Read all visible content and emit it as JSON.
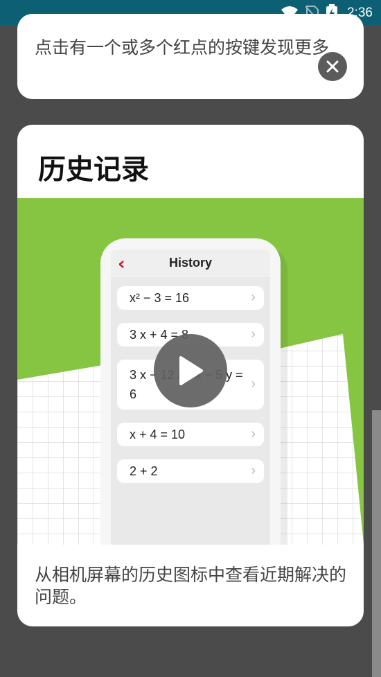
{
  "status": {
    "time": "2:36"
  },
  "top_card": {
    "text": "点击有一个或多个红点的按键发现更多"
  },
  "history_card": {
    "title": "历史记录",
    "description": "从相机屏幕的历史图标中查看近期解决的问题。",
    "phone": {
      "header_title": "History",
      "rows": [
        "x² − 3 = 16",
        "3 x + 4 = 8",
        "3 x − 12 / 4 x − 5 y = 6",
        "x + 4 = 10",
        "2 + 2"
      ]
    }
  },
  "colors": {
    "status_bar": "#0d5f74",
    "overlay": "#4b4b4b",
    "illustration_green": "#86c541",
    "back_arrow": "#c8102e"
  }
}
